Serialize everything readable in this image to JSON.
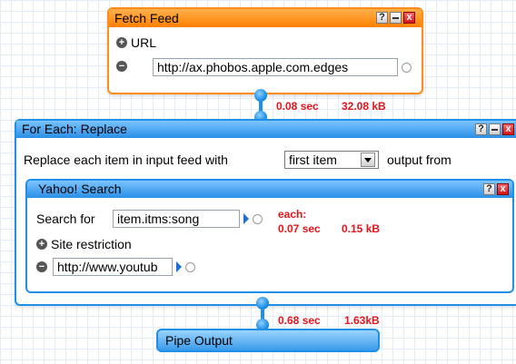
{
  "fetch_feed": {
    "title": "Fetch Feed",
    "url_label": "URL",
    "url_value": "http://ax.phobos.apple.com.edges",
    "help_label": "?",
    "close_label": "x"
  },
  "connector1": {
    "time": "0.08 sec",
    "size": "32.08 kB"
  },
  "for_each": {
    "title": "For Each: Replace",
    "help_label": "?",
    "close_label": "x",
    "line_prefix": "Replace each item in input feed with",
    "select_value": "first item",
    "line_suffix": "output from"
  },
  "yahoo_search": {
    "title": "Yahoo! Search",
    "help_label": "?",
    "close_label": "x",
    "search_label": "Search for",
    "search_value": "item.itms:song",
    "each_label": "each:",
    "each_time": "0.07 sec",
    "each_size": "0.15 kB",
    "site_restriction_label": "Site restriction",
    "site_value": "http://www.youtub"
  },
  "connector2": {
    "time": "0.68 sec",
    "size": "1.63kB"
  },
  "pipe_output": {
    "title": "Pipe Output"
  },
  "colors": {
    "orange": "#ff8c1a",
    "blue": "#1f8fe8",
    "stat_red": "#e8141a"
  }
}
